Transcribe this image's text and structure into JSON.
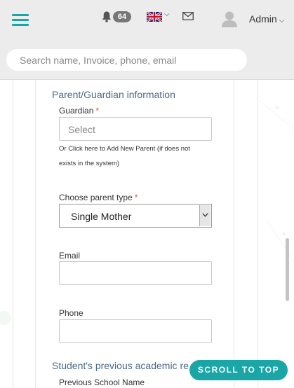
{
  "header": {
    "notifications_count": "64",
    "user_label": "Admin",
    "search": {
      "placeholder": "Search name, Invoice, phone, email",
      "value": ""
    }
  },
  "form": {
    "section_title": "Parent/Guardian information",
    "guardian": {
      "label": "Guardian",
      "required_mark": "*",
      "placeholder": "Select",
      "help_line1": "Or Click here to Add New Parent (if does not",
      "help_line2": "exists in the system)"
    },
    "parent_type": {
      "label": "Choose parent type",
      "required_mark": "*",
      "value": "Single Mother"
    },
    "email": {
      "label": "Email",
      "value": ""
    },
    "phone": {
      "label": "Phone",
      "value": ""
    },
    "next_section_title": "Student's previous academic re",
    "previous_school_label": "Previous School Name"
  },
  "scroll_top_label": "SCROLL TO TOP",
  "colors": {
    "accent": "#1aa6a6",
    "section_title": "#4a6a8a",
    "required": "#d9534f"
  }
}
